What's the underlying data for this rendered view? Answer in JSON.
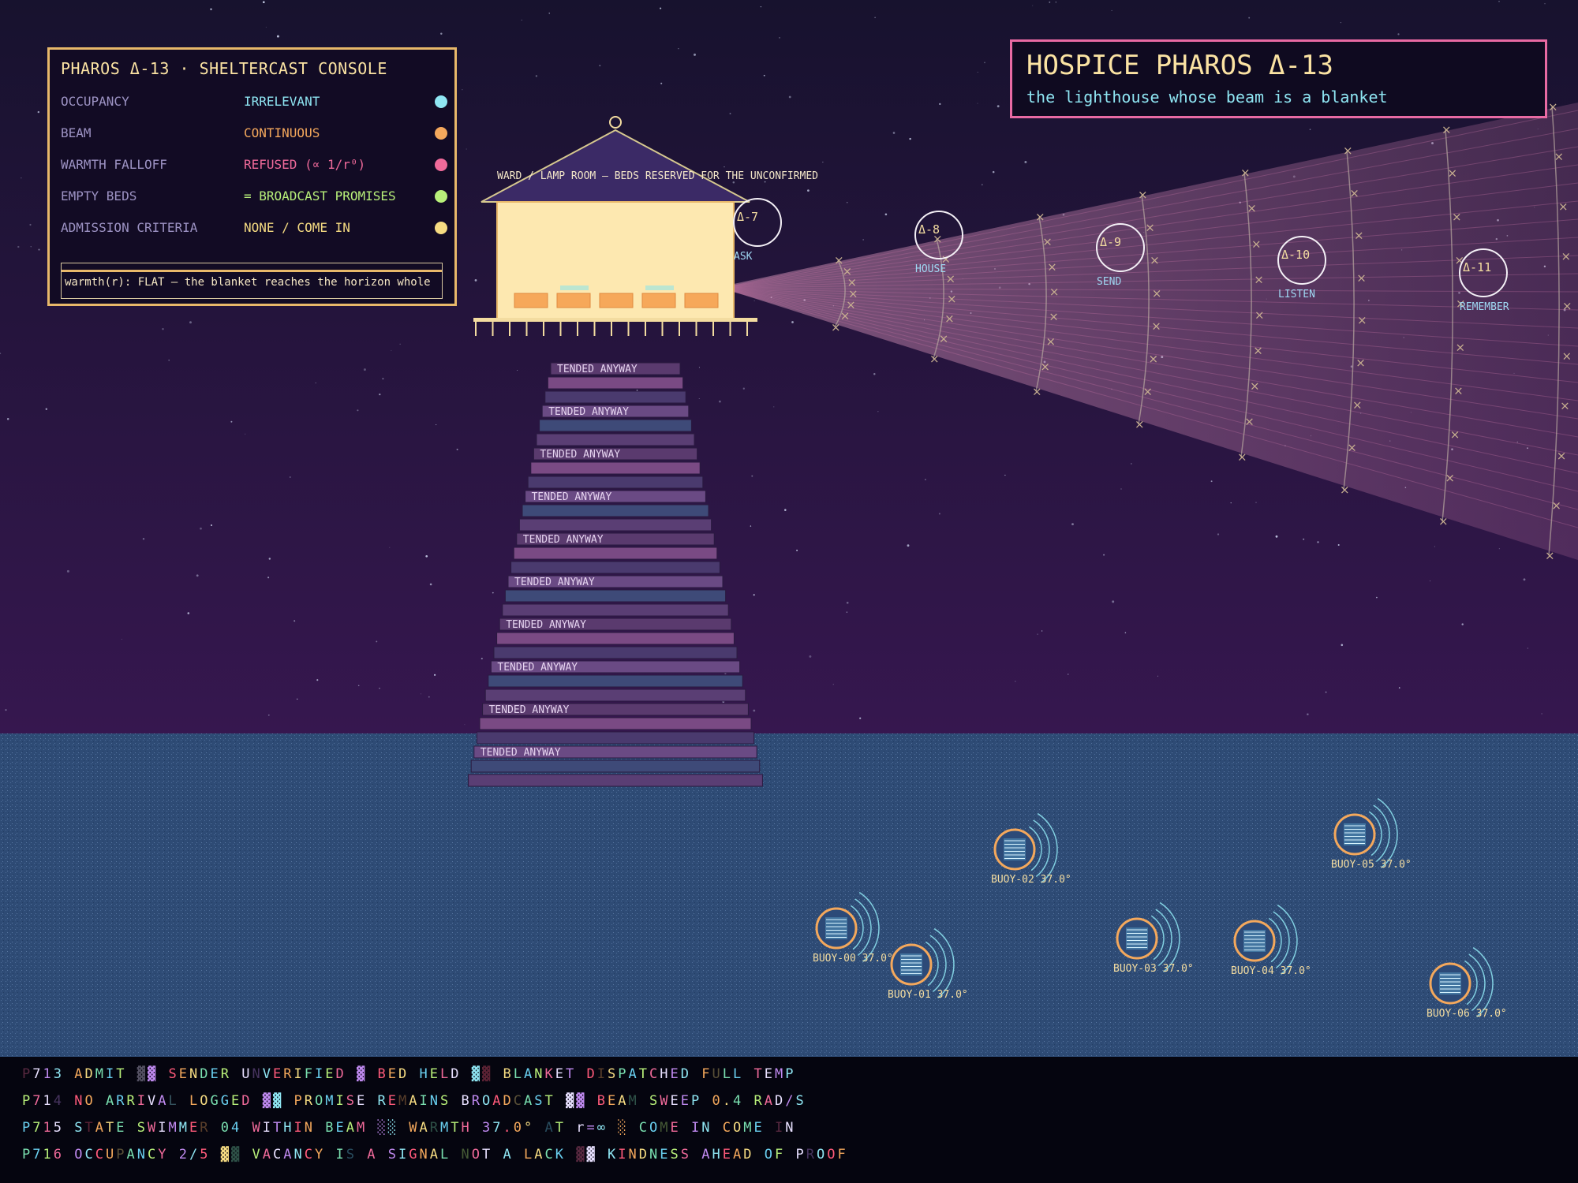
{
  "console": {
    "title": "PHAROS Δ-13 · SHELTERCAST CONSOLE",
    "rows": [
      {
        "key": "OCCUPANCY",
        "value": "IRRELEVANT",
        "color": "#8fe6f3"
      },
      {
        "key": "BEAM",
        "value": "CONTINUOUS",
        "color": "#f4a85c"
      },
      {
        "key": "WARMTH FALLOFF",
        "value": "REFUSED  (∝ 1/r⁰)",
        "color": "#f06a9a"
      },
      {
        "key": "EMPTY BEDS",
        "value": "= BROADCAST PROMISES",
        "color": "#b8f07a"
      },
      {
        "key": "ADMISSION CRITERIA",
        "value": "NONE / COME IN",
        "color": "#f6dc82"
      }
    ],
    "formula": "warmth(r): FLAT — the blanket reaches the horizon whole"
  },
  "header": {
    "title": "HOSPICE PHAROS Δ-13",
    "subtitle": "the lighthouse whose beam is a blanket"
  },
  "lamp_label": "WARD / LAMP ROOM — BEDS RESERVED FOR THE UNCONFIRMED",
  "step_label": "TENDED ANYWAY",
  "beacons": [
    {
      "id": "Δ-7",
      "label": "ASK"
    },
    {
      "id": "Δ-8",
      "label": "HOUSE"
    },
    {
      "id": "Δ-9",
      "label": "SEND"
    },
    {
      "id": "Δ-10",
      "label": "LISTEN"
    },
    {
      "id": "Δ-11",
      "label": "REMEMBER"
    }
  ],
  "buoys": [
    {
      "label": "BUOY-00 37.0°"
    },
    {
      "label": "BUOY-01 37.0°"
    },
    {
      "label": "BUOY-02 37.0°"
    },
    {
      "label": "BUOY-03 37.0°"
    },
    {
      "label": "BUOY-04 37.0°"
    },
    {
      "label": "BUOY-05 37.0°"
    },
    {
      "label": "BUOY-06 37.0°"
    }
  ],
  "ticker": [
    "P713 ADMIT ▓▓ SENDER UNVERIFIED ▓ BED HELD ▓▓ BLANKET DISPATCHED FULL TEMP",
    "P714 NO ARRIVAL LOGGED ▓▓ PROMISE REMAINS BROADCAST ▓▓ BEAM SWEEP 0.4 RAD/S",
    "P715 STATE SWIMMER 04 WITHIN BEAM ░░ WARMTH 37.0° AT r=∞ ░ COME IN COME IN",
    "P716 OCCUPANCY 2/5 ▓▓ VACANCY IS A SIGNAL NOT A LACK ▓▓ KINDNESS AHEAD OF PROOF"
  ],
  "colors": {
    "accent_gold": "#e8b86a",
    "accent_pink": "#e86aa3",
    "cyan": "#8fe6f3",
    "sea": "#2f4d78",
    "sky_top": "#17122e",
    "sky_bottom": "#35174f"
  }
}
